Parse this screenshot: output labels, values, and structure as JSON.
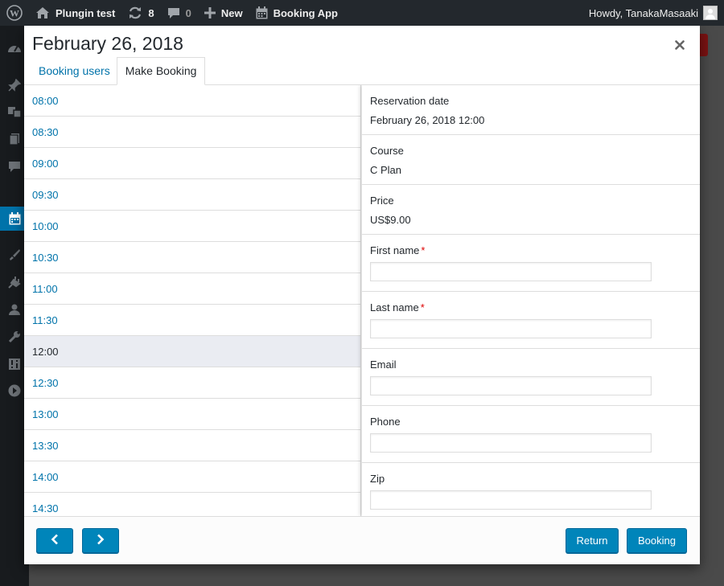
{
  "admin_bar": {
    "site_name": "Plungin test",
    "updates_count": "8",
    "comments_count": "0",
    "new_label": "New",
    "app_label": "Booking App",
    "greeting": "Howdy, TanakaMasaaki"
  },
  "modal": {
    "title": "February 26, 2018",
    "tabs": [
      {
        "label": "Booking users"
      },
      {
        "label": "Make Booking",
        "active": true
      }
    ]
  },
  "slots": [
    {
      "time": "08:00"
    },
    {
      "time": "08:30"
    },
    {
      "time": "09:00"
    },
    {
      "time": "09:30"
    },
    {
      "time": "10:00"
    },
    {
      "time": "10:30"
    },
    {
      "time": "11:00"
    },
    {
      "time": "11:30"
    },
    {
      "time": "12:00",
      "selected": true
    },
    {
      "time": "12:30"
    },
    {
      "time": "13:00"
    },
    {
      "time": "13:30"
    },
    {
      "time": "14:00"
    },
    {
      "time": "14:30"
    }
  ],
  "form": {
    "reservation_date": {
      "label": "Reservation date",
      "value": "February 26, 2018 12:00"
    },
    "course": {
      "label": "Course",
      "value": "C Plan"
    },
    "price": {
      "label": "Price",
      "value": "US$9.00"
    },
    "first_name": {
      "label": "First name",
      "required_mark": "*",
      "value": ""
    },
    "last_name": {
      "label": "Last name",
      "required_mark": "*",
      "value": ""
    },
    "email": {
      "label": "Email",
      "value": ""
    },
    "phone": {
      "label": "Phone",
      "value": ""
    },
    "zip": {
      "label": "Zip",
      "value": ""
    }
  },
  "footer": {
    "return_label": "Return",
    "booking_label": "Booking"
  },
  "colors": {
    "accent": "#0073aa",
    "button": "#0085ba",
    "admin_bar": "#23282d",
    "selected_row": "#eaecf2",
    "required": "#dd0000"
  },
  "icons": [
    "wordpress-icon",
    "home-icon",
    "updates-icon",
    "comments-icon",
    "plus-icon",
    "calendar-icon",
    "close-icon",
    "chevron-left-icon",
    "chevron-right-icon"
  ]
}
